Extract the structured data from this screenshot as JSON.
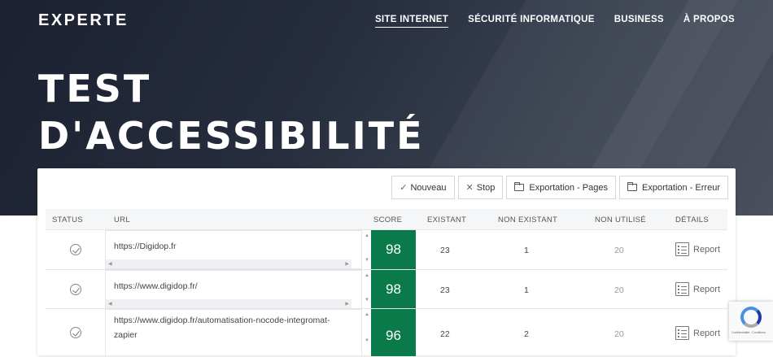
{
  "header": {
    "logo": "EXPERTE",
    "nav": [
      {
        "label": "SITE INTERNET",
        "active": true
      },
      {
        "label": "SÉCURITÉ INFORMATIQUE",
        "active": false
      },
      {
        "label": "BUSINESS",
        "active": false
      },
      {
        "label": "À PROPOS",
        "active": false
      }
    ],
    "title_line1": "TEST",
    "title_line2": "D'ACCESSIBILITÉ"
  },
  "toolbar": {
    "new_label": "Nouveau",
    "stop_label": "Stop",
    "export_pages_label": "Exportation - Pages",
    "export_errors_label": "Exportation - Erreur"
  },
  "table": {
    "headers": {
      "status": "STATUS",
      "url": "URL",
      "score": "SCORE",
      "existing": "EXISTANT",
      "not_existing": "NON EXISTANT",
      "unused": "NON UTILISÉ",
      "details": "DÉTAILS"
    },
    "rows": [
      {
        "url": "https://Digidop.fr",
        "score": "98",
        "existing": "23",
        "not_existing": "1",
        "unused": "20",
        "details": "Report"
      },
      {
        "url": "https://www.digidop.fr/",
        "score": "98",
        "existing": "23",
        "not_existing": "1",
        "unused": "20",
        "details": "Report"
      },
      {
        "url": "https://www.digidop.fr/automatisation-nocode-integromat-zapier",
        "score": "96",
        "existing": "22",
        "not_existing": "2",
        "unused": "20",
        "details": "Report"
      }
    ]
  },
  "recaptcha": {
    "text": "Confidentialité - Conditions"
  },
  "colors": {
    "score_bg": "#0a7a4b",
    "hero_bg": "#1b2130"
  }
}
